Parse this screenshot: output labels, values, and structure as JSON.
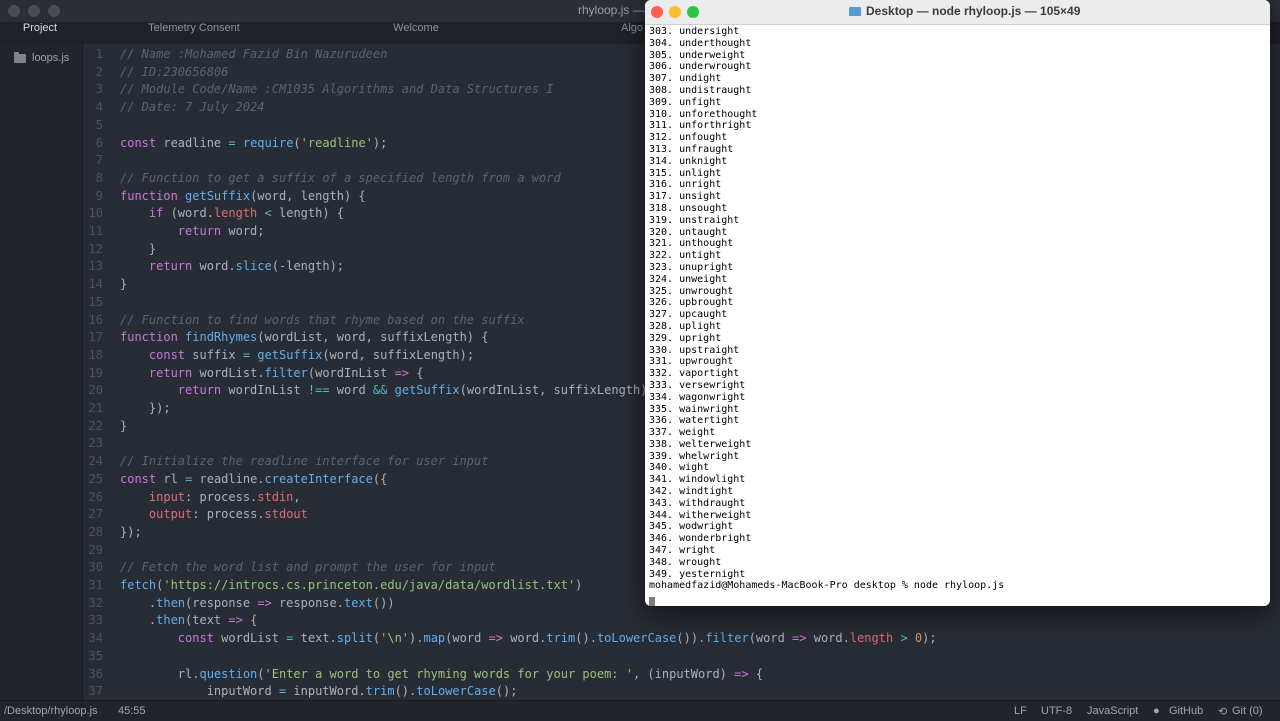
{
  "editor": {
    "title": "rhyloop.js —",
    "tabs": [
      "Project",
      "Telemetry Consent",
      "Welcome",
      "Algo"
    ],
    "sidebar_file": "loops.js",
    "lines": [
      {
        "n": "1",
        "t": [
          [
            "c",
            "// Name :Mohamed Fazid Bin Nazurudeen"
          ]
        ]
      },
      {
        "n": "2",
        "t": [
          [
            "c",
            "// ID:230656806"
          ]
        ]
      },
      {
        "n": "3",
        "t": [
          [
            "c",
            "// Module Code/Name :CM1035 Algorithms and Data Structures I"
          ]
        ]
      },
      {
        "n": "4",
        "t": [
          [
            "c",
            "// Date: 7 July 2024"
          ]
        ]
      },
      {
        "n": "5",
        "t": []
      },
      {
        "n": "6",
        "t": [
          [
            "k",
            "const"
          ],
          [
            "code",
            " readline "
          ],
          [
            "o",
            "="
          ],
          [
            "code",
            " "
          ],
          [
            "f",
            "require"
          ],
          [
            "code",
            "("
          ],
          [
            "s",
            "'readline'"
          ],
          [
            "code",
            ");"
          ]
        ]
      },
      {
        "n": "7",
        "t": []
      },
      {
        "n": "8",
        "t": [
          [
            "c",
            "// Function to get a suffix of a specified length from a word"
          ]
        ]
      },
      {
        "n": "9",
        "t": [
          [
            "k",
            "function"
          ],
          [
            "code",
            " "
          ],
          [
            "f",
            "getSuffix"
          ],
          [
            "code",
            "(word, length) {"
          ]
        ]
      },
      {
        "n": "10",
        "t": [
          [
            "code",
            "    "
          ],
          [
            "k",
            "if"
          ],
          [
            "code",
            " (word."
          ],
          [
            "p",
            "length"
          ],
          [
            "code",
            " "
          ],
          [
            "o",
            "<"
          ],
          [
            "code",
            " length) {"
          ]
        ]
      },
      {
        "n": "11",
        "t": [
          [
            "code",
            "        "
          ],
          [
            "k",
            "return"
          ],
          [
            "code",
            " word;"
          ]
        ]
      },
      {
        "n": "12",
        "t": [
          [
            "code",
            "    }"
          ]
        ]
      },
      {
        "n": "13",
        "t": [
          [
            "code",
            "    "
          ],
          [
            "k",
            "return"
          ],
          [
            "code",
            " word."
          ],
          [
            "f",
            "slice"
          ],
          [
            "code",
            "("
          ],
          [
            "o",
            "-"
          ],
          [
            "code",
            "length);"
          ]
        ]
      },
      {
        "n": "14",
        "t": [
          [
            "code",
            "}"
          ]
        ]
      },
      {
        "n": "15",
        "t": []
      },
      {
        "n": "16",
        "t": [
          [
            "c",
            "// Function to find words that rhyme based on the suffix"
          ]
        ]
      },
      {
        "n": "17",
        "t": [
          [
            "k",
            "function"
          ],
          [
            "code",
            " "
          ],
          [
            "f",
            "findRhymes"
          ],
          [
            "code",
            "(wordList, word, suffixLength) {"
          ]
        ]
      },
      {
        "n": "18",
        "t": [
          [
            "code",
            "    "
          ],
          [
            "k",
            "const"
          ],
          [
            "code",
            " suffix "
          ],
          [
            "o",
            "="
          ],
          [
            "code",
            " "
          ],
          [
            "f",
            "getSuffix"
          ],
          [
            "code",
            "(word, suffixLength);"
          ]
        ]
      },
      {
        "n": "19",
        "t": [
          [
            "code",
            "    "
          ],
          [
            "k",
            "return"
          ],
          [
            "code",
            " wordList."
          ],
          [
            "f",
            "filter"
          ],
          [
            "code",
            "(wordInList "
          ],
          [
            "k",
            "=>"
          ],
          [
            "code",
            " {"
          ]
        ]
      },
      {
        "n": "20",
        "t": [
          [
            "code",
            "        "
          ],
          [
            "k",
            "return"
          ],
          [
            "code",
            " wordInList "
          ],
          [
            "o",
            "!=="
          ],
          [
            "code",
            " word "
          ],
          [
            "o",
            "&&"
          ],
          [
            "code",
            " "
          ],
          [
            "f",
            "getSuffix"
          ],
          [
            "code",
            "(wordInList, suffixLength)"
          ]
        ]
      },
      {
        "n": "21",
        "t": [
          [
            "code",
            "    });"
          ]
        ]
      },
      {
        "n": "22",
        "t": [
          [
            "code",
            "}"
          ]
        ]
      },
      {
        "n": "23",
        "t": []
      },
      {
        "n": "24",
        "t": [
          [
            "c",
            "// Initialize the readline interface for user input"
          ]
        ]
      },
      {
        "n": "25",
        "t": [
          [
            "k",
            "const"
          ],
          [
            "code",
            " rl "
          ],
          [
            "o",
            "="
          ],
          [
            "code",
            " readline."
          ],
          [
            "f",
            "createInterface"
          ],
          [
            "code",
            "({"
          ]
        ]
      },
      {
        "n": "26",
        "t": [
          [
            "code",
            "    "
          ],
          [
            "p",
            "input"
          ],
          [
            "code",
            ": process."
          ],
          [
            "p",
            "stdin"
          ],
          [
            "code",
            ","
          ]
        ]
      },
      {
        "n": "27",
        "t": [
          [
            "code",
            "    "
          ],
          [
            "p",
            "output"
          ],
          [
            "code",
            ": process."
          ],
          [
            "p",
            "stdout"
          ]
        ]
      },
      {
        "n": "28",
        "t": [
          [
            "code",
            "});"
          ]
        ]
      },
      {
        "n": "29",
        "t": []
      },
      {
        "n": "30",
        "t": [
          [
            "c",
            "// Fetch the word list and prompt the user for input"
          ]
        ]
      },
      {
        "n": "31",
        "t": [
          [
            "f",
            "fetch"
          ],
          [
            "code",
            "("
          ],
          [
            "s",
            "'https://introcs.cs.princeton.edu/java/data/wordlist.txt'"
          ],
          [
            "code",
            ")"
          ]
        ]
      },
      {
        "n": "32",
        "t": [
          [
            "code",
            "    ."
          ],
          [
            "f",
            "then"
          ],
          [
            "code",
            "(response "
          ],
          [
            "k",
            "=>"
          ],
          [
            "code",
            " response."
          ],
          [
            "f",
            "text"
          ],
          [
            "code",
            "())"
          ]
        ]
      },
      {
        "n": "33",
        "t": [
          [
            "code",
            "    ."
          ],
          [
            "f",
            "then"
          ],
          [
            "code",
            "(text "
          ],
          [
            "k",
            "=>"
          ],
          [
            "code",
            " {"
          ]
        ]
      },
      {
        "n": "34",
        "t": [
          [
            "code",
            "        "
          ],
          [
            "k",
            "const"
          ],
          [
            "code",
            " wordList "
          ],
          [
            "o",
            "="
          ],
          [
            "code",
            " text."
          ],
          [
            "f",
            "split"
          ],
          [
            "code",
            "("
          ],
          [
            "s",
            "'\\n'"
          ],
          [
            "code",
            ")."
          ],
          [
            "f",
            "map"
          ],
          [
            "code",
            "(word "
          ],
          [
            "k",
            "=>"
          ],
          [
            "code",
            " word."
          ],
          [
            "f",
            "trim"
          ],
          [
            "code",
            "()."
          ],
          [
            "f",
            "toLowerCase"
          ],
          [
            "code",
            "())."
          ],
          [
            "f",
            "filter"
          ],
          [
            "code",
            "(word "
          ],
          [
            "k",
            "=>"
          ],
          [
            "code",
            " word."
          ],
          [
            "p",
            "length"
          ],
          [
            "code",
            " "
          ],
          [
            "o",
            ">"
          ],
          [
            "code",
            " "
          ],
          [
            "n",
            "0"
          ],
          [
            "code",
            ");"
          ]
        ]
      },
      {
        "n": "35",
        "t": []
      },
      {
        "n": "36",
        "t": [
          [
            "code",
            "        rl."
          ],
          [
            "f",
            "question"
          ],
          [
            "code",
            "("
          ],
          [
            "s",
            "'Enter a word to get rhyming words for your poem: '"
          ],
          [
            "code",
            ", (inputWord) "
          ],
          [
            "k",
            "=>"
          ],
          [
            "code",
            " {"
          ]
        ]
      },
      {
        "n": "37",
        "t": [
          [
            "code",
            "            inputWord "
          ],
          [
            "o",
            "="
          ],
          [
            "code",
            " inputWord."
          ],
          [
            "f",
            "trim"
          ],
          [
            "code",
            "()."
          ],
          [
            "f",
            "toLowerCase"
          ],
          [
            "code",
            "();"
          ]
        ]
      }
    ],
    "status": {
      "path": "/Desktop/rhyloop.js",
      "cursor": "45:55",
      "eol": "LF",
      "encoding": "UTF-8",
      "grammar": "JavaScript",
      "github": "GitHub",
      "git": "Git (0)"
    }
  },
  "terminal": {
    "title": "Desktop — node rhyloop.js — 105×49",
    "lines": [
      "303. undersight",
      "304. underthought",
      "305. underweight",
      "306. underwrought",
      "307. undight",
      "308. undistraught",
      "309. unfight",
      "310. unforethought",
      "311. unforthright",
      "312. unfought",
      "313. unfraught",
      "314. unknight",
      "315. unlight",
      "316. unright",
      "317. unsight",
      "318. unsought",
      "319. unstraight",
      "320. untaught",
      "321. unthought",
      "322. untight",
      "323. unupright",
      "324. unweight",
      "325. unwrought",
      "326. upbrought",
      "327. upcaught",
      "328. uplight",
      "329. upright",
      "330. upstraight",
      "331. upwrought",
      "332. vaportight",
      "333. versewright",
      "334. wagonwright",
      "335. wainwright",
      "336. watertight",
      "337. weight",
      "338. welterweight",
      "339. whelwright",
      "340. wight",
      "341. windowlight",
      "342. windtight",
      "343. withdraught",
      "344. witherweight",
      "345. wodwright",
      "346. wonderbright",
      "347. wright",
      "348. wrought",
      "349. yesternight"
    ],
    "prompt": "mohamedfazid@Mohameds-MacBook-Pro desktop % node rhyloop.js"
  }
}
